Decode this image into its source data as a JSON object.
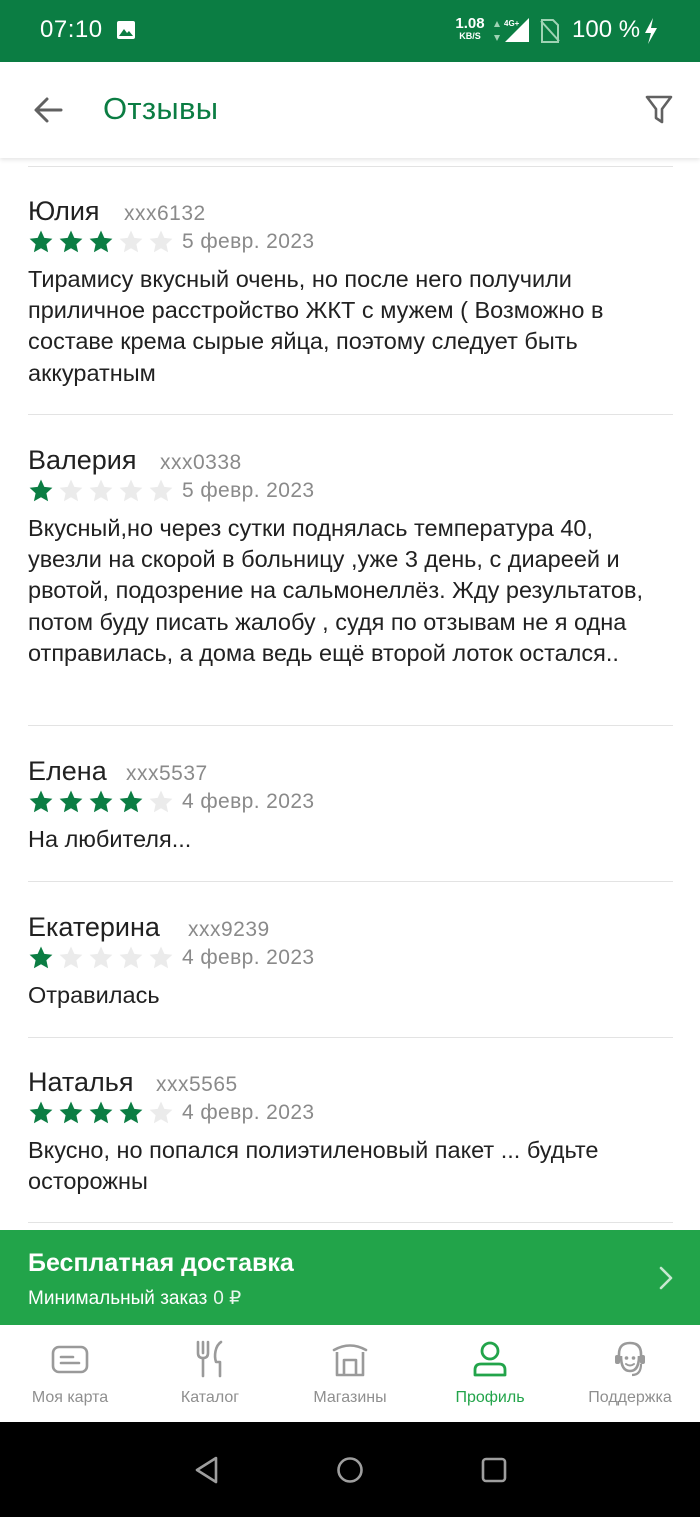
{
  "status_bar": {
    "time": "07:10",
    "speed_value": "1.08",
    "speed_unit": "KB/S",
    "network": "4G+",
    "battery": "100 %"
  },
  "header": {
    "title": "Отзывы",
    "back_icon": "arrow-left-icon",
    "filter_icon": "filter-icon"
  },
  "reviews": [
    {
      "name": "Юлия",
      "phone": "xxx6132",
      "rating": 3,
      "date": "5 февр. 2023",
      "text": "Тирамису вкусный очень, но после него получили приличное расстройство ЖКТ с мужем ( Возможно в составе крема сырые яйца, поэтому следует быть аккуратным"
    },
    {
      "name": "Валерия",
      "phone": "xxx0338",
      "rating": 1,
      "date": "5 февр. 2023",
      "text": "Вкусный,но через сутки поднялась температура 40, увезли на скорой в больницу ,уже 3 день, с диареей и рвотой, подозрение на сальмонеллёз. Жду результатов, потом буду писать жалобу , судя по отзывам не я одна отправилась, а дома ведь ещё второй лоток остался.."
    },
    {
      "name": "Елена",
      "phone": "xxx5537",
      "rating": 4,
      "date": "4 февр. 2023",
      "text": "На любителя..."
    },
    {
      "name": "Екатерина",
      "phone": "xxx9239",
      "rating": 1,
      "date": "4 февр. 2023",
      "text": "Отравилась"
    },
    {
      "name": "Наталья",
      "phone": "xxx5565",
      "rating": 4,
      "date": "4 февр. 2023",
      "text": "Вкусно, но попался полиэтиленовый пакет ... будьте осторожны"
    }
  ],
  "banner": {
    "title": "Бесплатная доставка",
    "subtitle": "Минимальный заказ",
    "amount": "0 ₽"
  },
  "bottom_nav": [
    {
      "label": "Моя карта",
      "icon": "card-icon",
      "active": false
    },
    {
      "label": "Каталог",
      "icon": "fork-knife-icon",
      "active": false
    },
    {
      "label": "Магазины",
      "icon": "store-icon",
      "active": false
    },
    {
      "label": "Профиль",
      "icon": "profile-icon",
      "active": true
    },
    {
      "label": "Поддержка",
      "icon": "support-icon",
      "active": false
    }
  ],
  "colors": {
    "brand_green": "#0b7d43",
    "banner_green": "#22a44a",
    "star_filled": "#0b7d43",
    "star_empty": "#ebebeb"
  }
}
